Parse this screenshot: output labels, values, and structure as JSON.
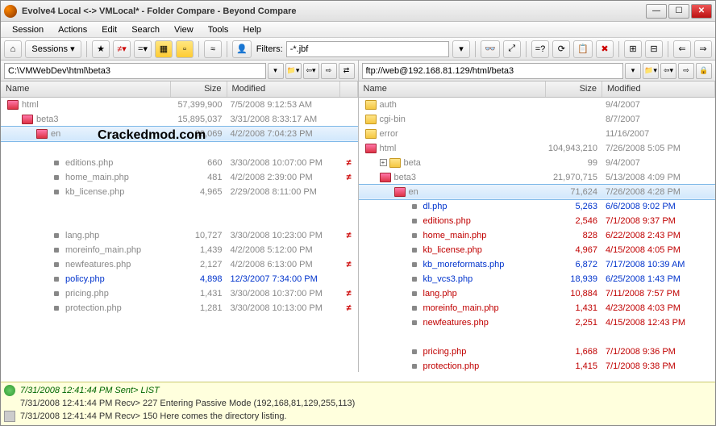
{
  "window": {
    "title": "Evolve4  Local <-> VMLocal* - Folder Compare - Beyond Compare"
  },
  "menu": {
    "session": "Session",
    "actions": "Actions",
    "edit": "Edit",
    "search": "Search",
    "view": "View",
    "tools": "Tools",
    "help": "Help"
  },
  "toolbar": {
    "sessions": "Sessions",
    "filters_label": "Filters:",
    "filters_value": "-*.jbf"
  },
  "paths": {
    "left": "C:\\VMWebDev\\html\\beta3",
    "right": "ftp://web@192.168.81.129/html/beta3"
  },
  "columns": {
    "name": "Name",
    "size": "Size",
    "modified": "Modified"
  },
  "watermark": "Crackedmod.com",
  "left_rows": [
    {
      "indent": 0,
      "type": "folder",
      "icon": "red",
      "name": "html",
      "size": "57,399,900",
      "mod": "7/5/2008 9:12:53 AM",
      "cls": "gray"
    },
    {
      "indent": 1,
      "type": "folder",
      "icon": "red",
      "name": "beta3",
      "size": "15,895,037",
      "mod": "3/31/2008 8:33:17 AM",
      "cls": "gray"
    },
    {
      "indent": 2,
      "type": "folder",
      "icon": "red",
      "name": "en",
      "size": "39,069",
      "mod": "4/2/2008 7:04:23 PM",
      "cls": "gray",
      "sel": true
    },
    {
      "indent": 3,
      "type": "spacer"
    },
    {
      "indent": 3,
      "type": "file",
      "name": "editions.php",
      "size": "660",
      "mod": "3/30/2008 10:07:00 PM",
      "cls": "gray",
      "diff": "≠"
    },
    {
      "indent": 3,
      "type": "file",
      "name": "home_main.php",
      "size": "481",
      "mod": "4/2/2008 2:39:00 PM",
      "cls": "gray",
      "diff": "≠"
    },
    {
      "indent": 3,
      "type": "file",
      "name": "kb_license.php",
      "size": "4,965",
      "mod": "2/29/2008 8:11:00 PM",
      "cls": "gray"
    },
    {
      "indent": 3,
      "type": "spacer"
    },
    {
      "indent": 3,
      "type": "spacer"
    },
    {
      "indent": 3,
      "type": "file",
      "name": "lang.php",
      "size": "10,727",
      "mod": "3/30/2008 10:23:00 PM",
      "cls": "gray",
      "diff": "≠"
    },
    {
      "indent": 3,
      "type": "file",
      "name": "moreinfo_main.php",
      "size": "1,439",
      "mod": "4/2/2008 5:12:00 PM",
      "cls": "gray"
    },
    {
      "indent": 3,
      "type": "file",
      "name": "newfeatures.php",
      "size": "2,127",
      "mod": "4/2/2008 6:13:00 PM",
      "cls": "gray",
      "diff": "≠"
    },
    {
      "indent": 3,
      "type": "file",
      "name": "policy.php",
      "size": "4,898",
      "mod": "12/3/2007 7:34:00 PM",
      "cls": "blue"
    },
    {
      "indent": 3,
      "type": "file",
      "name": "pricing.php",
      "size": "1,431",
      "mod": "3/30/2008 10:37:00 PM",
      "cls": "gray",
      "diff": "≠"
    },
    {
      "indent": 3,
      "type": "file",
      "name": "protection.php",
      "size": "1,281",
      "mod": "3/30/2008 10:13:00 PM",
      "cls": "gray",
      "diff": "≠"
    }
  ],
  "right_rows": [
    {
      "indent": 0,
      "type": "folder",
      "icon": "yel",
      "name": "auth",
      "size": "",
      "mod": "9/4/2007",
      "cls": "gray"
    },
    {
      "indent": 0,
      "type": "folder",
      "icon": "yel",
      "name": "cgi-bin",
      "size": "",
      "mod": "8/7/2007",
      "cls": "gray"
    },
    {
      "indent": 0,
      "type": "folder",
      "icon": "yel",
      "name": "error",
      "size": "",
      "mod": "11/16/2007",
      "cls": "gray"
    },
    {
      "indent": 0,
      "type": "folder",
      "icon": "red",
      "name": "html",
      "size": "104,943,210",
      "mod": "7/26/2008 5:05 PM",
      "cls": "gray"
    },
    {
      "indent": 1,
      "type": "folder",
      "icon": "yel",
      "plus": true,
      "name": "beta",
      "size": "99",
      "mod": "9/4/2007",
      "cls": "gray"
    },
    {
      "indent": 1,
      "type": "folder",
      "icon": "red",
      "name": "beta3",
      "size": "21,970,715",
      "mod": "5/13/2008 4:09 PM",
      "cls": "gray"
    },
    {
      "indent": 2,
      "type": "folder",
      "icon": "red",
      "name": "en",
      "size": "71,624",
      "mod": "7/26/2008 4:28 PM",
      "cls": "gray",
      "sel": true
    },
    {
      "indent": 3,
      "type": "file",
      "name": "dl.php",
      "size": "5,263",
      "mod": "6/6/2008 9:02 PM",
      "cls": "blue"
    },
    {
      "indent": 3,
      "type": "file",
      "name": "editions.php",
      "size": "2,546",
      "mod": "7/1/2008 9:37 PM",
      "cls": "red"
    },
    {
      "indent": 3,
      "type": "file",
      "name": "home_main.php",
      "size": "828",
      "mod": "6/22/2008 2:43 PM",
      "cls": "red"
    },
    {
      "indent": 3,
      "type": "file",
      "name": "kb_license.php",
      "size": "4,967",
      "mod": "4/15/2008 4:05 PM",
      "cls": "red"
    },
    {
      "indent": 3,
      "type": "file",
      "name": "kb_moreformats.php",
      "size": "6,872",
      "mod": "7/17/2008 10:39 AM",
      "cls": "blue"
    },
    {
      "indent": 3,
      "type": "file",
      "name": "kb_vcs3.php",
      "size": "18,939",
      "mod": "6/25/2008 1:43 PM",
      "cls": "blue"
    },
    {
      "indent": 3,
      "type": "file",
      "name": "lang.php",
      "size": "10,884",
      "mod": "7/11/2008 7:57 PM",
      "cls": "red"
    },
    {
      "indent": 3,
      "type": "file",
      "name": "moreinfo_main.php",
      "size": "1,431",
      "mod": "4/23/2008 4:03 PM",
      "cls": "red"
    },
    {
      "indent": 3,
      "type": "file",
      "name": "newfeatures.php",
      "size": "2,251",
      "mod": "4/15/2008 12:43 PM",
      "cls": "red"
    },
    {
      "indent": 3,
      "type": "spacer"
    },
    {
      "indent": 3,
      "type": "file",
      "name": "pricing.php",
      "size": "1,668",
      "mod": "7/1/2008 9:36 PM",
      "cls": "red"
    },
    {
      "indent": 3,
      "type": "file",
      "name": "protection.php",
      "size": "1,415",
      "mod": "7/1/2008 9:38 PM",
      "cls": "red"
    }
  ],
  "log": [
    {
      "icon": "g",
      "text": "7/31/2008 12:41:44 PM  Sent>  LIST",
      "cls": "logtxt"
    },
    {
      "icon": "",
      "text": "7/31/2008 12:41:44 PM  Recv>  227 Entering Passive Mode (192,168,81,129,255,113)",
      "cls": "logtxt nb"
    },
    {
      "icon": "d",
      "text": "7/31/2008 12:41:44 PM  Recv>  150 Here comes the directory listing.",
      "cls": "logtxt nb"
    }
  ]
}
